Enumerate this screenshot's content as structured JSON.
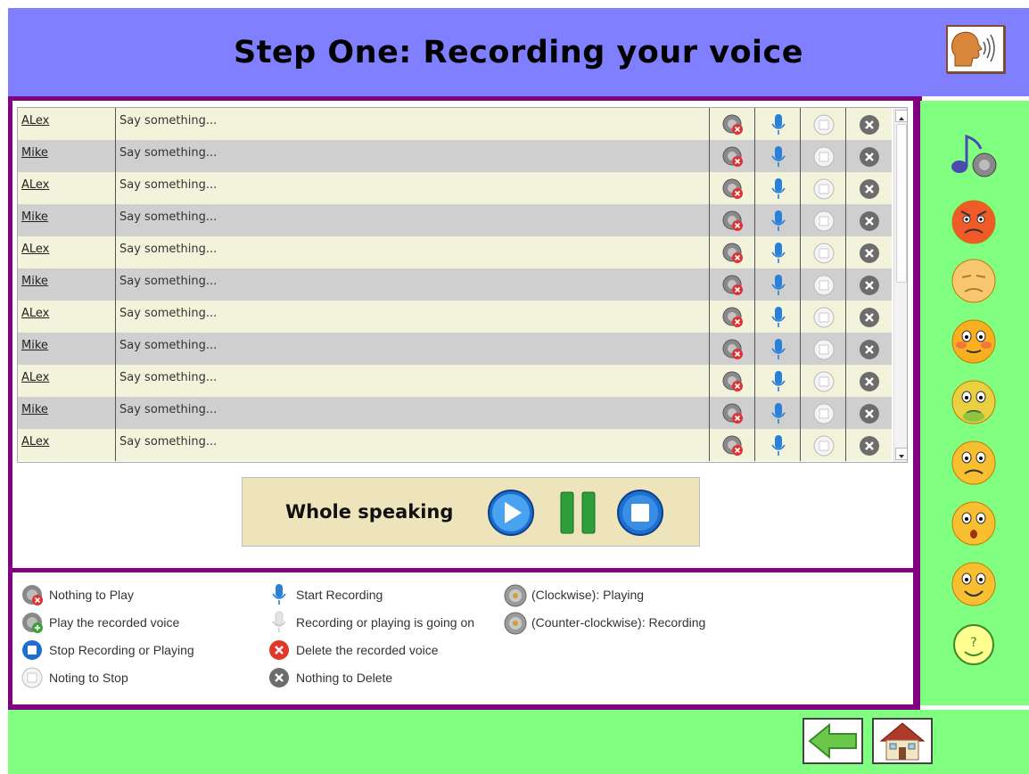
{
  "header": {
    "title": "Step One:  Recording your voice",
    "speaker_icon": "speaking-head-icon"
  },
  "rows": [
    {
      "name": "ALex",
      "text": "Say something..."
    },
    {
      "name": "Mike",
      "text": "Say something..."
    },
    {
      "name": "ALex",
      "text": "Say something..."
    },
    {
      "name": "Mike",
      "text": "Say something..."
    },
    {
      "name": "ALex",
      "text": "Say something..."
    },
    {
      "name": "Mike",
      "text": "Say something..."
    },
    {
      "name": "ALex",
      "text": "Say something..."
    },
    {
      "name": "Mike",
      "text": "Say something..."
    },
    {
      "name": "ALex",
      "text": "Say something..."
    },
    {
      "name": "Mike",
      "text": "Say something..."
    },
    {
      "name": "ALex",
      "text": "Say something..."
    }
  ],
  "whole": {
    "label": "Whole speaking"
  },
  "legend": {
    "nothing_to_play": "Nothing to Play",
    "play_recorded": "Play the recorded voice",
    "stop_recording": "Stop Recording or Playing",
    "nothing_to_stop": "Noting to Stop",
    "start_recording": "Start Recording",
    "recording_going_on": "Recording or playing is going on",
    "delete_recorded": "Delete the recorded voice",
    "nothing_to_delete": "Nothing to Delete",
    "clockwise": "(Clockwise): Playing",
    "counter_clockwise": "(Counter-clockwise): Recording"
  },
  "sidebar": {
    "icons": [
      "music-note-icon",
      "angry-face-icon",
      "disgusted-face-icon",
      "blushing-face-icon",
      "sick-face-icon",
      "sad-face-icon",
      "surprised-face-icon",
      "happy-face-icon",
      "question-face-icon"
    ]
  },
  "colors": {
    "header": "#7f7fff",
    "frame": "#800080",
    "sidebar": "#80ff80",
    "row_even": "#f3f3dc",
    "row_odd": "#cfcfcf",
    "accent": "#2a7fd6"
  }
}
